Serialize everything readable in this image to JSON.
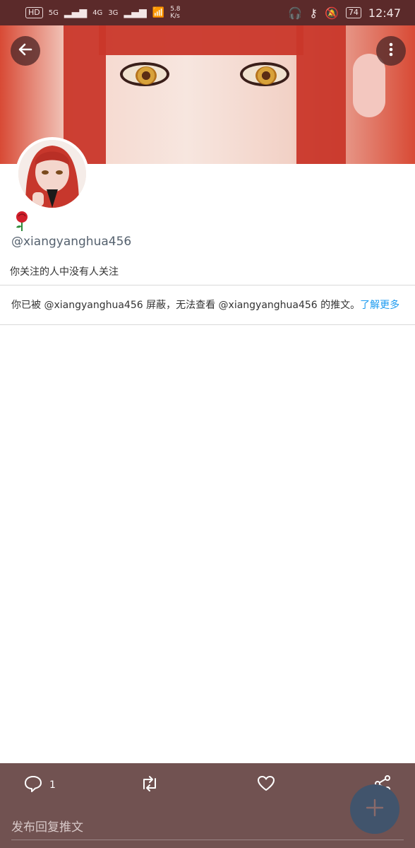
{
  "status": {
    "network_labels": [
      "HD",
      "5G",
      "4G",
      "3G"
    ],
    "speed_value": "5.8",
    "speed_unit": "K/s",
    "battery": "74",
    "time": "12:47"
  },
  "profile": {
    "handle": "@xiangyanghua456",
    "follow_info": "你关注的人中没有人关注",
    "blocked_message_prefix": "你已被 @xiangyanghua456 屏蔽，无法查看 @xiangyanghua456 的推文。",
    "learn_more": "了解更多"
  },
  "bottom": {
    "reply_count": "1",
    "reply_placeholder": "发布回复推文"
  },
  "colors": {
    "statusbar": "#5b2a2a",
    "bottombar": "#715251",
    "fab": "#41546c",
    "link": "#1d9bf0"
  },
  "icons": {
    "back": "back-arrow-icon",
    "more": "vertical-ellipsis-icon",
    "reply": "speech-bubble-icon",
    "retweet": "retweet-icon",
    "like": "heart-icon",
    "share": "share-icon",
    "compose": "plus-icon"
  }
}
